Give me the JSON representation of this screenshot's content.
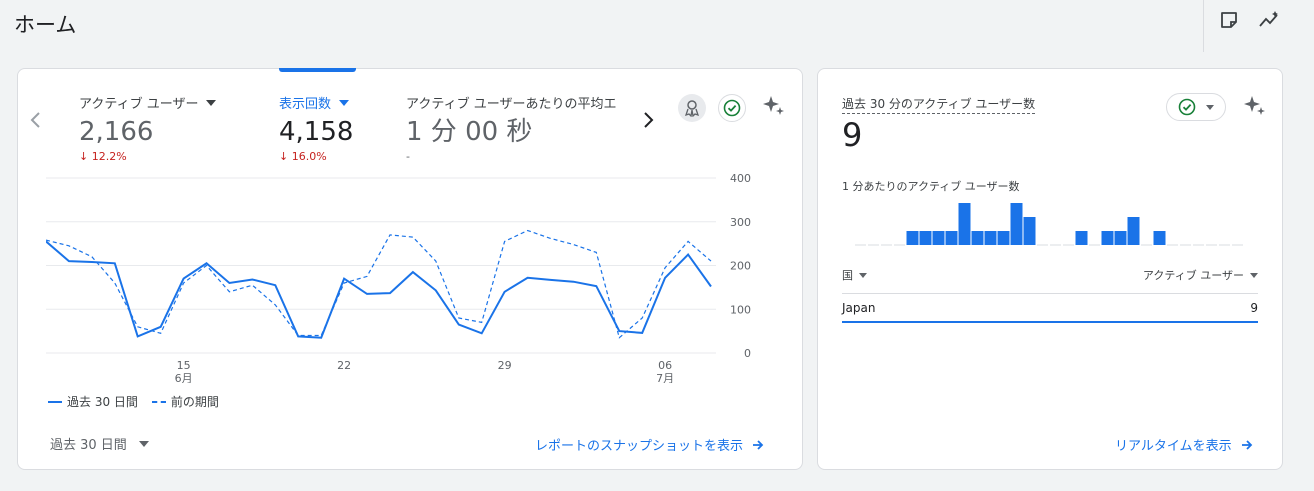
{
  "header": {
    "title": "ホーム"
  },
  "metrics": [
    {
      "label": "アクティブ ユーザー",
      "value": "2,166",
      "change": "12.2%",
      "active": false
    },
    {
      "label": "表示回数",
      "value": "4,158",
      "change": "16.0%",
      "active": true
    },
    {
      "label": "アクティブ ユーザーあたりの平均エ",
      "value": "1 分 00 秒",
      "change": "-",
      "active": false
    }
  ],
  "chart_data": {
    "type": "line",
    "x_ticks": [
      {
        "label": "15",
        "sub": "6月",
        "index": 6
      },
      {
        "label": "22",
        "sub": "",
        "index": 13
      },
      {
        "label": "29",
        "sub": "",
        "index": 20
      },
      {
        "label": "06",
        "sub": "7月",
        "index": 27
      }
    ],
    "ylim": [
      0,
      400
    ],
    "y_ticks": [
      0,
      100,
      200,
      300,
      400
    ],
    "series": [
      {
        "name": "過去 30 日間",
        "style": "solid",
        "values": [
          255,
          210,
          208,
          205,
          38,
          60,
          170,
          205,
          160,
          168,
          155,
          38,
          35,
          170,
          135,
          137,
          185,
          143,
          65,
          45,
          140,
          172,
          167,
          163,
          153,
          50,
          46,
          172,
          225,
          152
        ]
      },
      {
        "name": "前の期間",
        "style": "dashed",
        "values": [
          258,
          245,
          220,
          160,
          60,
          45,
          160,
          200,
          140,
          155,
          110,
          40,
          40,
          160,
          175,
          270,
          265,
          210,
          80,
          70,
          255,
          280,
          262,
          248,
          230,
          35,
          80,
          195,
          255,
          210
        ]
      }
    ],
    "grid": true,
    "legend": "bottom-left"
  },
  "footer": {
    "range_label": "過去 30 日間",
    "snapshot_link": "レポートのスナップショットを表示"
  },
  "realtime": {
    "title": "過去 30 分のアクティブ ユーザー数",
    "value": "9",
    "subtitle": "1 分あたりのアクティブ ユーザー数",
    "bars": [
      0,
      0,
      0,
      0,
      1,
      1,
      1,
      1,
      3,
      1,
      1,
      1,
      3,
      2,
      0,
      0,
      0,
      1,
      0,
      1,
      1,
      2,
      0,
      1,
      0,
      0,
      0,
      0,
      0,
      0
    ],
    "col_country": "国",
    "col_users": "アクティブ ユーザー",
    "rows": [
      {
        "country": "Japan",
        "users": "9"
      }
    ],
    "link": "リアルタイムを表示"
  },
  "colors": {
    "accent": "#1a73e8",
    "negative": "#c5221f",
    "check": "#188038"
  }
}
